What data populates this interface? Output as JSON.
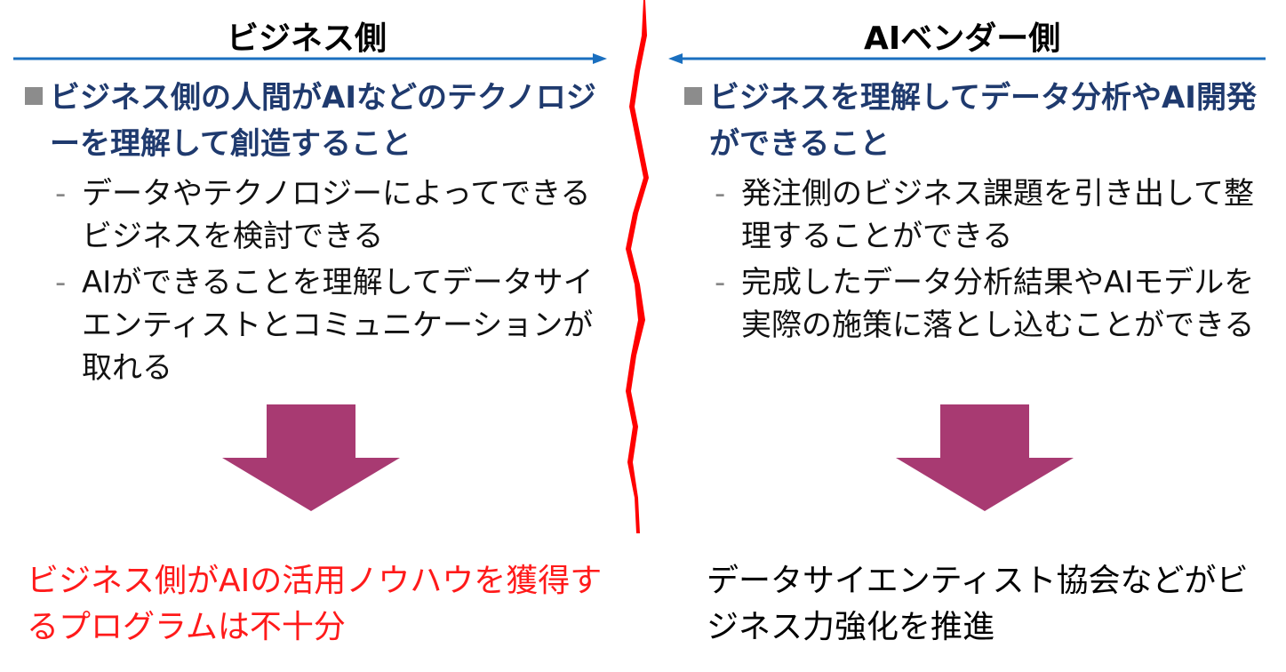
{
  "left": {
    "title": "ビジネス側",
    "heading": "ビジネス側の人間がAIなどのテクノロジーを理解して創造すること",
    "items": [
      "データやテクノロジーによってできるビジネスを検討できる",
      "AIができることを理解してデータサイエンティストとコミュニケーションが取れる"
    ],
    "conclusion": "ビジネス側がAIの活用ノウハウを獲得するプログラムは不十分"
  },
  "right": {
    "title": "AIベンダー側",
    "heading": "ビジネスを理解してデータ分析やAI開発ができること",
    "items": [
      "発注側のビジネス課題を引き出して整理することができる",
      "完成したデータ分析結果やAIモデルを実際の施策に落とし込むことができる"
    ],
    "conclusion": "データサイエンティスト協会などがビジネス力強化を推進"
  },
  "colors": {
    "arrow_line": "#1a6fbf",
    "divider": "#ff0000",
    "heading": "#1f3a6e",
    "down_arrow": "#a83a72",
    "left_conclusion": "#ff1a1a",
    "right_conclusion": "#000000",
    "bullet": "#8c8c8c"
  },
  "icons": {
    "bullet": "square-bullet",
    "sub_bullet": "dash",
    "divider": "lightning-divider",
    "down_arrow": "down-arrow"
  }
}
